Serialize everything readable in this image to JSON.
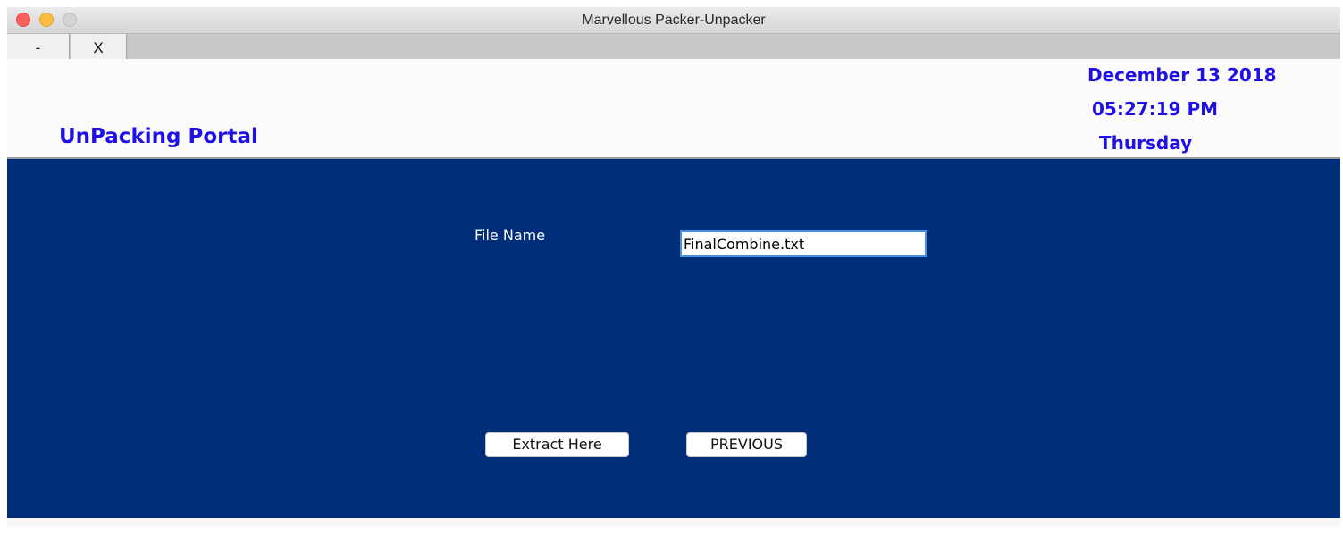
{
  "window": {
    "title": "Marvellous Packer-Unpacker"
  },
  "tabs": {
    "minimize_label": "-",
    "close_label": "X"
  },
  "header": {
    "portal_title": "UnPacking Portal",
    "date": "December 13 2018",
    "time": "05:27:19 PM",
    "day": "Thursday"
  },
  "form": {
    "file_label": "File Name",
    "file_value": "FinalCombine.txt"
  },
  "buttons": {
    "extract_label": "Extract Here",
    "previous_label": "PREVIOUS"
  },
  "colors": {
    "panel_background": "#002d7a",
    "header_text": "#1f10e6",
    "traffic_close": "#fc605c",
    "traffic_minimize": "#fdbc40",
    "traffic_maximize": "#d4d4d4"
  }
}
